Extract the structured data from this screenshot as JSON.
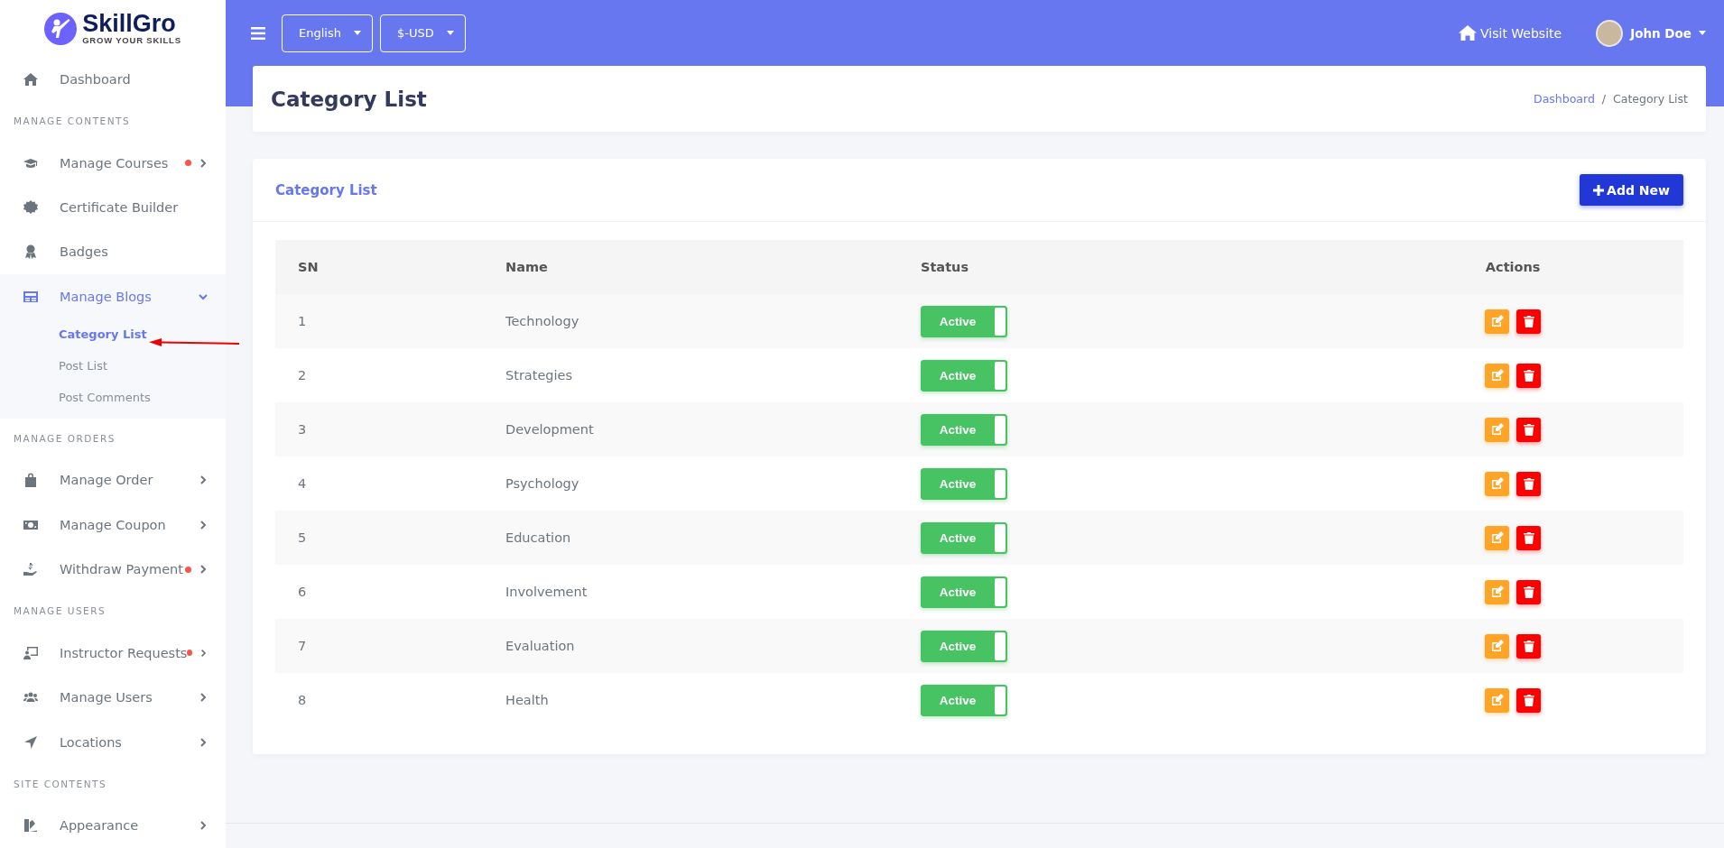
{
  "brand": {
    "name": "SkillGro",
    "tagline": "GROW YOUR SKILLS"
  },
  "sidebar": {
    "sections": [
      {
        "items": [
          {
            "label": "Dashboard",
            "selected": false,
            "has_dot": false
          }
        ]
      },
      {
        "heading": "MANAGE CONTENTS",
        "items": [
          {
            "label": "Manage Courses",
            "selected": false,
            "expanded": false,
            "has_dot": true
          },
          {
            "label": "Certificate Builder",
            "selected": false,
            "has_dot": false
          },
          {
            "label": "Badges",
            "selected": false,
            "has_dot": false
          },
          {
            "label": "Manage Blogs",
            "selected": true,
            "expanded": true,
            "has_dot": false,
            "children": [
              {
                "label": "Category List",
                "selected": true
              },
              {
                "label": "Post List",
                "selected": false
              },
              {
                "label": "Post Comments",
                "selected": false
              }
            ]
          }
        ]
      },
      {
        "heading": "MANAGE ORDERS",
        "items": [
          {
            "label": "Manage Order",
            "selected": false,
            "expanded": false,
            "has_dot": false
          },
          {
            "label": "Manage Coupon",
            "selected": false,
            "expanded": false,
            "has_dot": false
          },
          {
            "label": "Withdraw Payment",
            "selected": false,
            "expanded": false,
            "has_dot": true
          }
        ]
      },
      {
        "heading": "MANAGE USERS",
        "items": [
          {
            "label": "Instructor Requests",
            "selected": false,
            "expanded": false,
            "has_dot": true
          },
          {
            "label": "Manage Users",
            "selected": false,
            "expanded": false,
            "has_dot": false
          },
          {
            "label": "Locations",
            "selected": false,
            "expanded": false,
            "has_dot": false
          }
        ]
      },
      {
        "heading": "SITE CONTENTS",
        "items": [
          {
            "label": "Appearance",
            "selected": false,
            "expanded": false,
            "has_dot": false
          }
        ]
      }
    ]
  },
  "topbar": {
    "language": "English",
    "currency": "$-USD",
    "visit_link": "Visit Website",
    "user": "John Doe"
  },
  "page_header": {
    "title": "Category List",
    "breadcrumb": [
      "Dashboard",
      "Category List"
    ],
    "breadcrumb_separator": "/"
  },
  "card": {
    "title": "Category List",
    "add_button": "Add New",
    "table": {
      "columns": [
        "SN",
        "Name",
        "Status",
        "Actions"
      ],
      "rows": [
        {
          "sn": "1",
          "name": "Technology",
          "status": "Active",
          "on": true
        },
        {
          "sn": "2",
          "name": "Strategies",
          "status": "Active",
          "on": true
        },
        {
          "sn": "3",
          "name": "Development",
          "status": "Active",
          "on": true
        },
        {
          "sn": "4",
          "name": "Psychology",
          "status": "Active",
          "on": true
        },
        {
          "sn": "5",
          "name": "Education",
          "status": "Active",
          "on": true
        },
        {
          "sn": "6",
          "name": "Involvement",
          "status": "Active",
          "on": true
        },
        {
          "sn": "7",
          "name": "Evaluation",
          "status": "Active",
          "on": true
        },
        {
          "sn": "8",
          "name": "Health",
          "status": "Active",
          "on": true
        }
      ]
    }
  }
}
